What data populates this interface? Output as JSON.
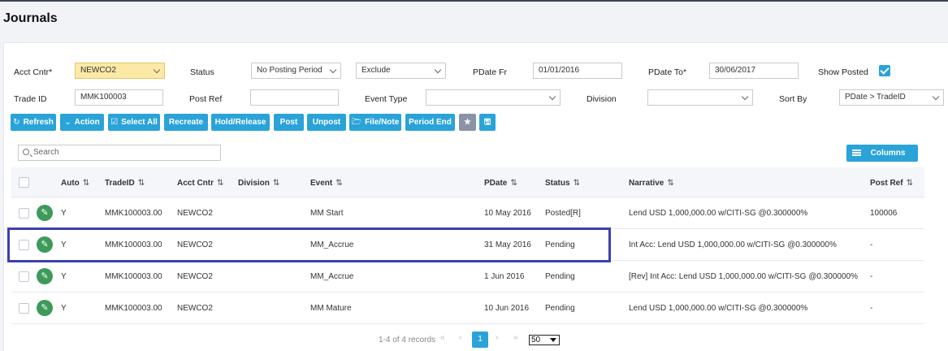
{
  "page": {
    "title": "Journals"
  },
  "filters": {
    "acct_cntr_label": "Acct Cntr*",
    "acct_cntr_value": "NEWCO2",
    "status_label": "Status",
    "status_value": "No Posting Period",
    "exclude_value": "Exclude",
    "pdate_fr_label": "PDate Fr",
    "pdate_fr_value": "01/01/2016",
    "pdate_to_label": "PDate To*",
    "pdate_to_value": "30/06/2017",
    "show_posted_label": "Show Posted",
    "show_posted_checked": true,
    "trade_id_label": "Trade ID",
    "trade_id_value": "MMK100003",
    "post_ref_label": "Post Ref",
    "post_ref_value": "",
    "event_type_label": "Event Type",
    "event_type_value": "",
    "division_label": "Division",
    "division_value": "",
    "sort_by_label": "Sort By",
    "sort_by_value": "PDate > TradeID"
  },
  "toolbar": {
    "refresh": "Refresh",
    "action": "Action",
    "select_all": "Select All",
    "recreate": "Recreate",
    "hold_release": "Hold/Release",
    "post": "Post",
    "unpost": "Unpost",
    "file_note": "File/Note",
    "period_end": "Period End",
    "icons": [
      "refresh-icon",
      "chevron-down-icon",
      "checkbox-icon",
      "folder-icon",
      "star-icon",
      "save-icon"
    ]
  },
  "search": {
    "placeholder": "Search"
  },
  "columns_button": "Columns",
  "table": {
    "headers": {
      "auto": "Auto",
      "trade_id": "TradeID",
      "acct_cntr": "Acct Cntr",
      "division": "Division",
      "event": "Event",
      "pdate": "PDate",
      "status": "Status",
      "narrative": "Narrative",
      "post_ref": "Post Ref"
    },
    "rows": [
      {
        "auto": "Y",
        "trade_id": "MMK100003.00",
        "acct_cntr": "NEWCO2",
        "division": "",
        "event": "MM Start",
        "pdate": "10 May 2016",
        "status": "Posted[R]",
        "narrative": "Lend USD 1,000,000.00 w/CITI-SG @0.300000%",
        "post_ref": "100006"
      },
      {
        "auto": "Y",
        "trade_id": "MMK100003.00",
        "acct_cntr": "NEWCO2",
        "division": "",
        "event": "MM_Accrue",
        "pdate": "31 May 2016",
        "status": "Pending",
        "narrative": "Int Acc: Lend USD 1,000,000.00 w/CITI-SG @0.300000%",
        "post_ref": "-"
      },
      {
        "auto": "Y",
        "trade_id": "MMK100003.00",
        "acct_cntr": "NEWCO2",
        "division": "",
        "event": "MM_Accrue",
        "pdate": "1 Jun 2016",
        "status": "Pending",
        "narrative": "[Rev] Int Acc: Lend USD 1,000,000.00 w/CITI-SG @0.300000%",
        "post_ref": "-"
      },
      {
        "auto": "Y",
        "trade_id": "MMK100003.00",
        "acct_cntr": "NEWCO2",
        "division": "",
        "event": "MM Mature",
        "pdate": "10 Jun 2016",
        "status": "Pending",
        "narrative": "Lend USD 1,000,000.00 w/CITI-SG @0.300000%",
        "post_ref": "-"
      }
    ]
  },
  "pagination": {
    "records_text": "1-4 of 4 records",
    "current_page": "1",
    "page_size": "50"
  },
  "colors": {
    "accent": "#2aa3d9",
    "edit": "#3d9a5b",
    "highlight": "#3c3fae",
    "acct_field": "#fde9a6"
  }
}
